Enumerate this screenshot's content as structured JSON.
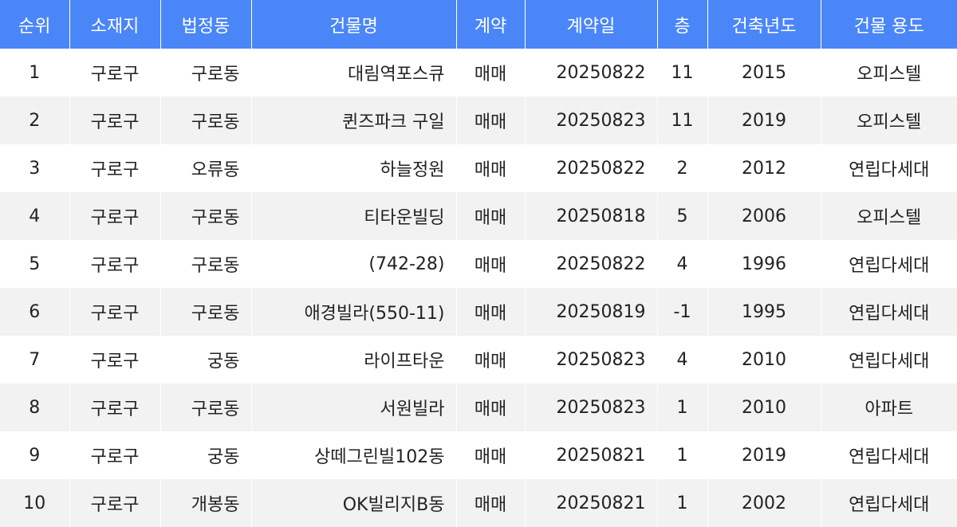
{
  "table": {
    "headers": [
      "순위",
      "소재지",
      "법정동",
      "건물명",
      "계약",
      "계약일",
      "층",
      "건축년도",
      "건물 용도"
    ],
    "rows": [
      [
        "1",
        "구로구",
        "구로동",
        "대림역포스큐",
        "매매",
        "20250822",
        "11",
        "2015",
        "오피스텔"
      ],
      [
        "2",
        "구로구",
        "구로동",
        "퀸즈파크 구일",
        "매매",
        "20250823",
        "11",
        "2019",
        "오피스텔"
      ],
      [
        "3",
        "구로구",
        "오류동",
        "하늘정원",
        "매매",
        "20250822",
        "2",
        "2012",
        "연립다세대"
      ],
      [
        "4",
        "구로구",
        "구로동",
        "티타운빌딩",
        "매매",
        "20250818",
        "5",
        "2006",
        "오피스텔"
      ],
      [
        "5",
        "구로구",
        "구로동",
        "(742-28)",
        "매매",
        "20250822",
        "4",
        "1996",
        "연립다세대"
      ],
      [
        "6",
        "구로구",
        "구로동",
        "애경빌라(550-11)",
        "매매",
        "20250819",
        "-1",
        "1995",
        "연립다세대"
      ],
      [
        "7",
        "구로구",
        "궁동",
        "라이프타운",
        "매매",
        "20250823",
        "4",
        "2010",
        "연립다세대"
      ],
      [
        "8",
        "구로구",
        "구로동",
        "서원빌라",
        "매매",
        "20250823",
        "1",
        "2010",
        "아파트"
      ],
      [
        "9",
        "구로구",
        "궁동",
        "상떼그린빌102동",
        "매매",
        "20250821",
        "1",
        "2019",
        "연립다세대"
      ],
      [
        "10",
        "구로구",
        "개봉동",
        "OK빌리지B동",
        "매매",
        "20250821",
        "1",
        "2002",
        "연립다세대"
      ]
    ]
  }
}
